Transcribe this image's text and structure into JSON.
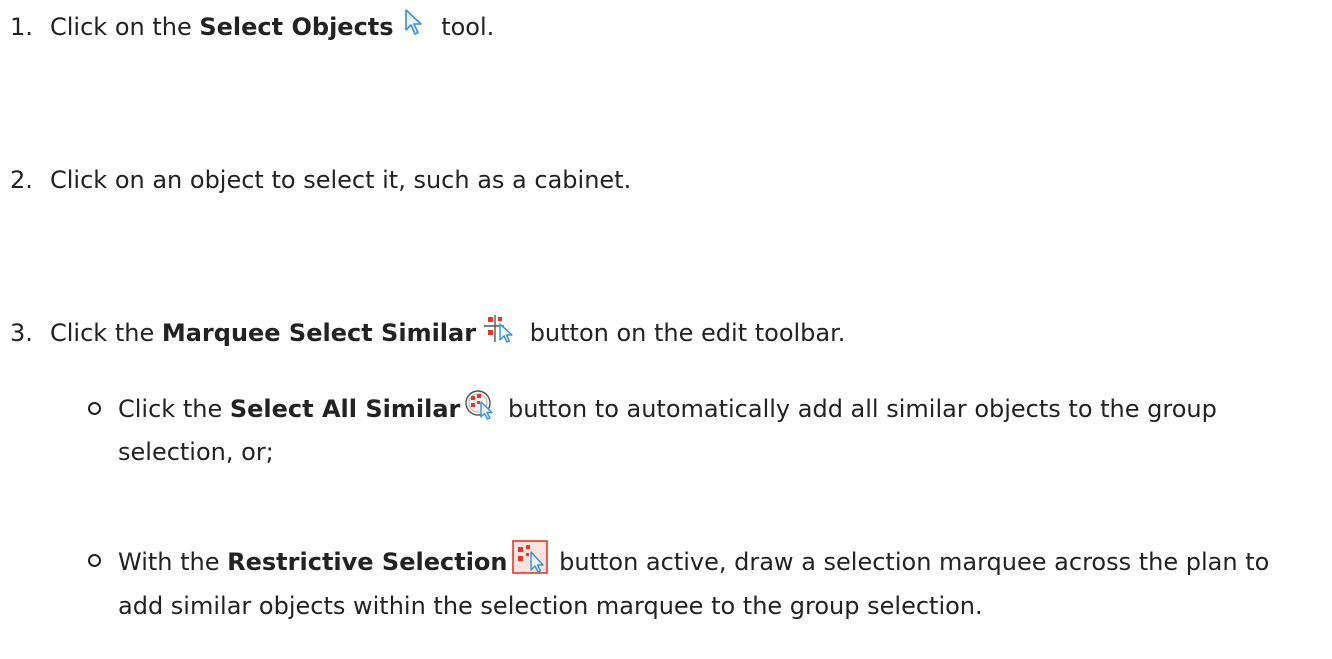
{
  "steps": [
    {
      "number": "1.",
      "before": "Click on the ",
      "bold": "Select Objects",
      "after": " tool.",
      "icon": "select-objects-cursor-icon"
    },
    {
      "number": "2.",
      "text": "Click on an object to select it, such as a cabinet."
    },
    {
      "number": "3.",
      "before": "Click the ",
      "bold": "Marquee Select Similar",
      "after": " button on the edit toolbar.",
      "icon": "marquee-select-similar-icon"
    }
  ],
  "substeps": [
    {
      "before": "Click the ",
      "bold": "Select All Similar",
      "after": " button to automatically add all similar objects to the group selection, or;",
      "icon": "select-all-similar-icon"
    },
    {
      "before": "With the ",
      "bold": "Restrictive Selection",
      "after": " button active, draw a selection marquee across the plan to add similar objects within the selection marquee to the group selection.",
      "icon": "restrictive-selection-icon"
    }
  ],
  "colors": {
    "text": "#222222",
    "icon_blue": "#3a8fd6",
    "icon_red": "#e0392b"
  }
}
